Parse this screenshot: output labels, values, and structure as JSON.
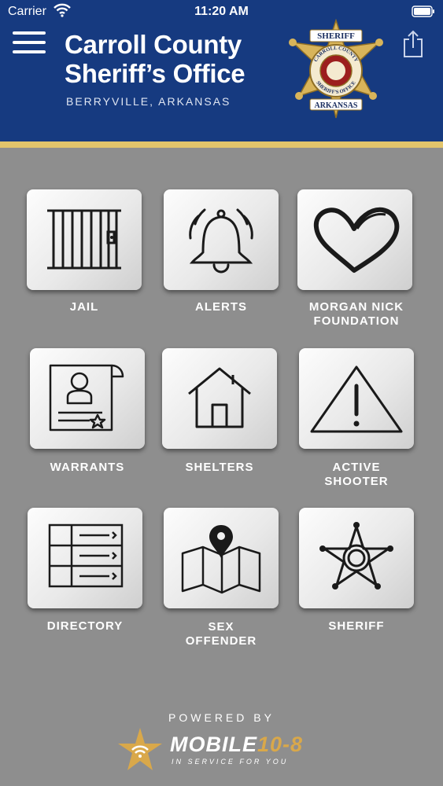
{
  "status": {
    "carrier": "Carrier",
    "time": "11:20 AM"
  },
  "header": {
    "title_line1": "Carroll County",
    "title_line2": "Sheriff’s Office",
    "subtitle": "BERRYVILLE, ARKANSAS",
    "badge": {
      "top": "SHERIFF",
      "ring_top": "CARROLL COUNTY",
      "ring_bottom": "SHERIFF'S OFFICE",
      "bottom": "ARKANSAS"
    }
  },
  "tiles": [
    {
      "label_line1": "JAIL",
      "label_line2": "",
      "icon": "jail-cell-icon"
    },
    {
      "label_line1": "ALERTS",
      "label_line2": "",
      "icon": "bell-icon"
    },
    {
      "label_line1": "MORGAN NICK",
      "label_line2": "FOUNDATION",
      "icon": "heart-icon"
    },
    {
      "label_line1": "WARRANTS",
      "label_line2": "",
      "icon": "warrant-document-icon"
    },
    {
      "label_line1": "SHELTERS",
      "label_line2": "",
      "icon": "house-icon"
    },
    {
      "label_line1": "ACTIVE",
      "label_line2": "SHOOTER",
      "icon": "warning-triangle-icon"
    },
    {
      "label_line1": "DIRECTORY",
      "label_line2": "",
      "icon": "directory-icon"
    },
    {
      "label_line1": "SEX",
      "label_line2": "OFFENDER",
      "icon": "map-pin-icon"
    },
    {
      "label_line1": "SHERIFF",
      "label_line2": "",
      "icon": "sheriff-star-icon"
    }
  ],
  "footer": {
    "powered_by": "POWERED BY",
    "logo_word": "MOBILE",
    "logo_accent": "10-8",
    "logo_tagline": "IN SERVICE FOR YOU"
  },
  "colors": {
    "header_bg": "#163a80",
    "gold": "#e2c46b",
    "background": "#8e8e8e"
  }
}
